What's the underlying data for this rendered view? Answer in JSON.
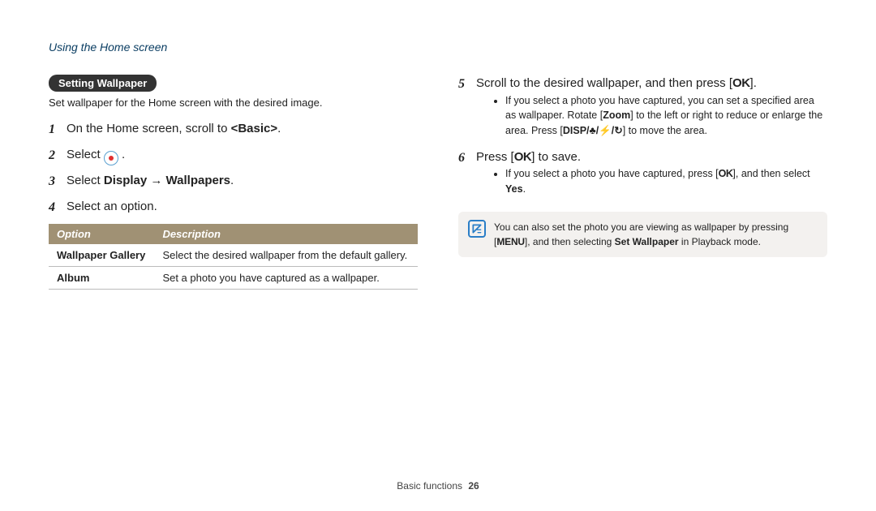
{
  "breadcrumb": "Using the Home screen",
  "left": {
    "pill": "Setting Wallpaper",
    "lead": "Set wallpaper for the Home screen with the desired image.",
    "steps": {
      "s1_pre": "On the Home screen, scroll to ",
      "s1_bold": "<Basic>",
      "s1_post": ".",
      "s2_pre": "Select ",
      "s2_post": " .",
      "s3_pre": "Select ",
      "s3_bold": "Display → Wallpapers",
      "s3_post": ".",
      "s4": "Select an option."
    },
    "table": {
      "h_option": "Option",
      "h_desc": "Description",
      "rows": [
        {
          "option": "Wallpaper Gallery",
          "desc": "Select the desired wallpaper from the default gallery."
        },
        {
          "option": "Album",
          "desc": "Set a photo you have captured as a wallpaper."
        }
      ]
    }
  },
  "right": {
    "step5": {
      "num": "5",
      "pre": "Scroll to the desired wallpaper, and then press [",
      "ok": "OK",
      "post": "].",
      "bullet_pre": "If you select a photo you have captured, you can set a specified area as wallpaper. Rotate [",
      "bullet_zoom": "Zoom",
      "bullet_mid": "] to the left or right to reduce or enlarge the area. Press [",
      "bullet_disp": "DISP/♣/⚡/↻",
      "bullet_post": "] to move the area."
    },
    "step6": {
      "num": "6",
      "pre": "Press [",
      "ok": "OK",
      "post": "] to save.",
      "bullet_pre": "If you select a photo you have captured, press [",
      "bullet_ok": "OK",
      "bullet_mid": "], and then select ",
      "bullet_yes": "Yes",
      "bullet_post": "."
    },
    "note": {
      "pre": "You can also set the photo you are viewing as wallpaper by pressing [",
      "menu": "MENU",
      "mid": "], and then selecting ",
      "bold": "Set Wallpaper",
      "post": " in Playback mode."
    }
  },
  "footer": {
    "section": "Basic functions",
    "page": "26"
  }
}
